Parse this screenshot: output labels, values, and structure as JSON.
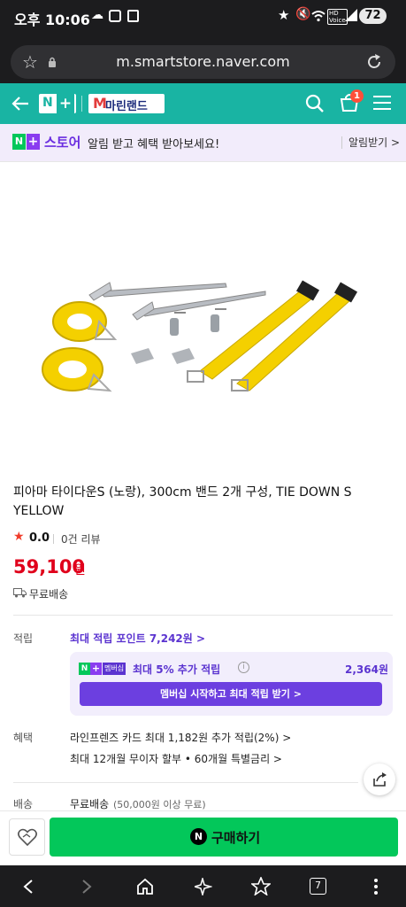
{
  "status": {
    "time": "오후 10:06",
    "battery": "72"
  },
  "browser": {
    "url": "m.smartstore.naver.com"
  },
  "header": {
    "store_name": "마린랜드",
    "cart_count": "1"
  },
  "nstore": {
    "brand": "스토어",
    "message": "알림 받고 혜택 받아보세요!",
    "action": "알림받기 >"
  },
  "product": {
    "title_line1": "피아마 타이다운S (노랑), 300cm 밴드 2개 구성, TIE DOWN S",
    "title_line2": "YELLOW",
    "rating": "0.0",
    "reviews": "0건 리뷰",
    "price_number": "59,100",
    "price_unit": "원",
    "shipping_badge": "무료배송"
  },
  "points": {
    "label": "적립",
    "max_points": "최대 적립 포인트 7,242원 >",
    "membership_tag": "멤버십",
    "extra": "최대 5% 추가 적립",
    "extra_amount": "2,364원",
    "cta": "멤버십 시작하고 최대 적립 받기 >"
  },
  "benefits": {
    "label": "혜택",
    "line1": "라인프렌즈 카드 최대 1,182원 추가 적립(2%) >",
    "line2": "최대 12개월 무이자 할부 • 60개월 특별금리 >"
  },
  "delivery": {
    "label": "배송",
    "value": "무료배송",
    "note": "(50,000원 이상 무료)"
  },
  "buy": {
    "label": "구매하기"
  },
  "colors": {
    "naver_green": "#03c75a",
    "header_teal": "#19b4a3",
    "price_red": "#e0001b",
    "point_purple": "#5b34d0"
  }
}
